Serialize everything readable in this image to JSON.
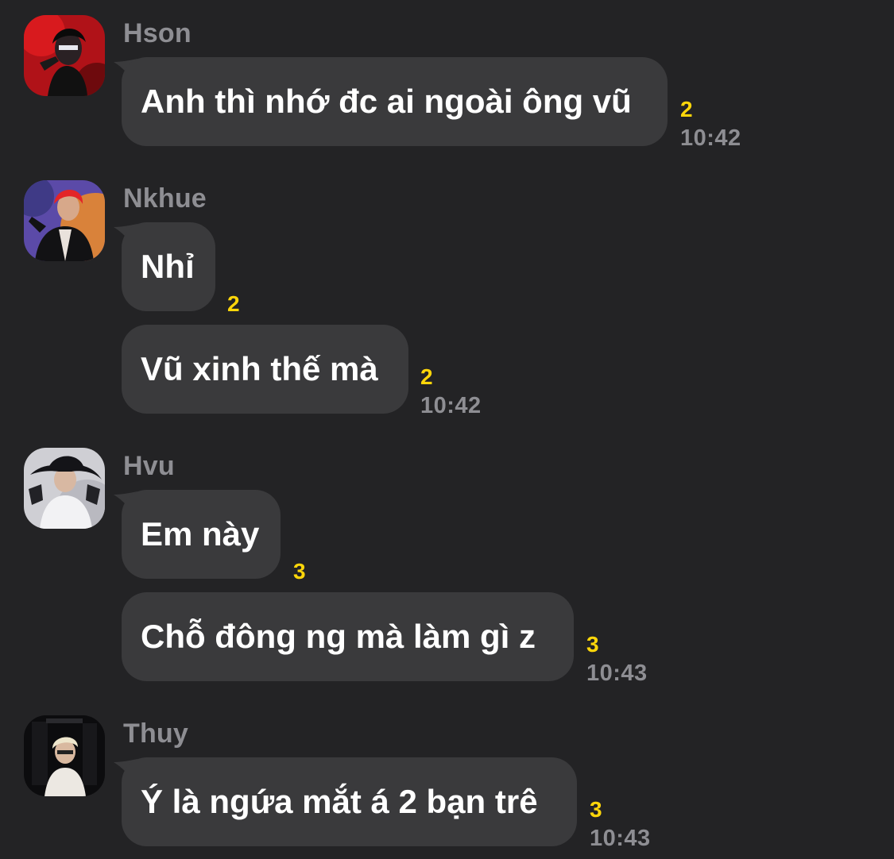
{
  "messages": [
    {
      "sender": "Hson",
      "text": "Anh thì nhớ đc ai ngoài ông vũ",
      "count": "2",
      "time": "10:42"
    },
    {
      "sender": "Nkhue",
      "text": "Nhỉ",
      "count": "2"
    },
    {
      "text": "Vũ xinh thế mà",
      "count": "2",
      "time": "10:42"
    },
    {
      "sender": "Hvu",
      "text": "Em này",
      "count": "3"
    },
    {
      "text": "Chỗ đông ng mà làm gì z",
      "count": "3",
      "time": "10:43"
    },
    {
      "sender": "Thuy",
      "text": "Ý là ngứa mắt á 2 bạn trê",
      "count": "3",
      "time": "10:43"
    }
  ],
  "colors": {
    "background": "#232325",
    "bubble": "#3a3a3c",
    "message_text": "#ffffff",
    "sender_name": "#8e8e93",
    "count": "#ffd60a",
    "timestamp": "#8e8e93"
  },
  "icons": {
    "avatar_hson": "avatar-photo",
    "avatar_nkhue": "avatar-photo",
    "avatar_hvu": "avatar-photo",
    "avatar_thuy": "avatar-photo"
  }
}
